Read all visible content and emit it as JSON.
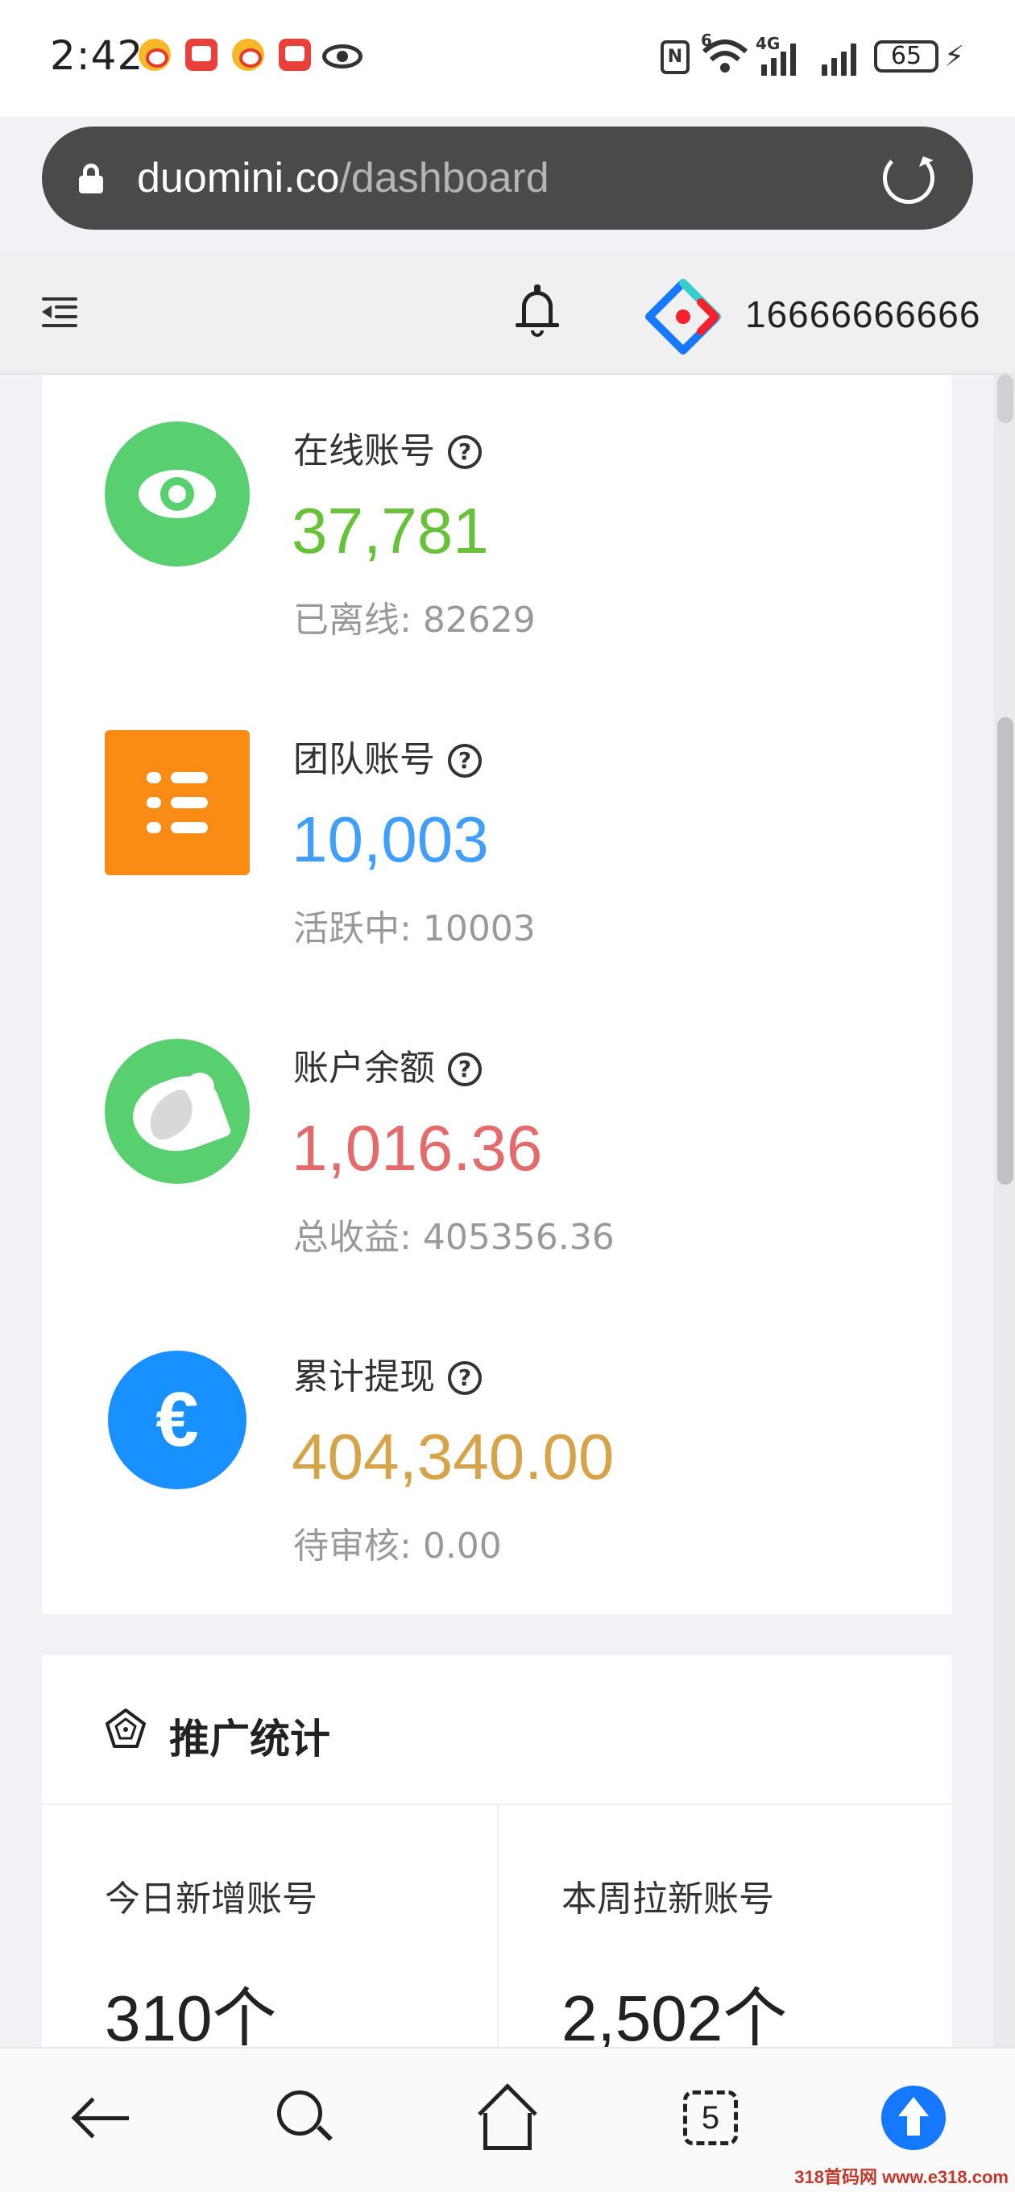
{
  "status_bar": {
    "time": "2:42",
    "notification_icons": [
      "weibo-icon",
      "red-app-icon",
      "weibo-icon",
      "red-app-icon",
      "eye-icon"
    ],
    "signal_label": "4G",
    "wifi_label": "6",
    "battery": "65"
  },
  "browser": {
    "url_domain": "duomini.co",
    "url_path": "/dashboard"
  },
  "header": {
    "phone": "16666666666"
  },
  "stats": [
    {
      "title": "在线账号",
      "value": "37,781",
      "sub_label": "已离线:",
      "sub_value": "82629",
      "color": "#67c23a",
      "icon": "eye-icon"
    },
    {
      "title": "团队账号",
      "value": "10,003",
      "sub_label": "活跃中:",
      "sub_value": "10003",
      "color": "#409eff",
      "icon": "list-icon"
    },
    {
      "title": "账户余额",
      "value": "1,016.36",
      "sub_label": "总收益:",
      "sub_value": "405356.36",
      "color": "#e36b6b",
      "icon": "bird-icon"
    },
    {
      "title": "累计提现",
      "value": "404,340.00",
      "sub_label": "待审核:",
      "sub_value": "0.00",
      "color": "#d4a34a",
      "icon": "euro-icon"
    }
  ],
  "promo": {
    "title": "推广统计",
    "cells": [
      {
        "label": "今日新增账号",
        "value": "310",
        "unit": "个"
      },
      {
        "label": "本周拉新账号",
        "value": "2,502",
        "unit": "个"
      }
    ]
  },
  "bottom_nav": {
    "tab_count": "5"
  },
  "watermark": "318首码网 www.e318.com"
}
